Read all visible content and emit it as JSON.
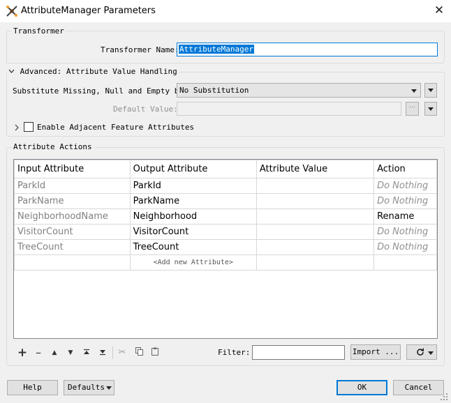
{
  "window": {
    "title": "AttributeManager Parameters",
    "close_glyph": "✕"
  },
  "transformer": {
    "group_title": "Transformer",
    "name_label": "Transformer Name:",
    "name_value": "AttributeManager"
  },
  "advanced": {
    "group_title": "Advanced: Attribute Value Handling",
    "substitute_label": "Substitute Missing, Null and Empty by:",
    "substitute_value": "No Substitution",
    "default_label": "Default Value:",
    "default_value": "",
    "ellipsis": "···",
    "adjacent_label": "Enable Adjacent Feature Attributes",
    "adjacent_checked": false
  },
  "actions": {
    "group_title": "Attribute Actions",
    "columns": [
      "Input Attribute",
      "Output Attribute",
      "Attribute Value",
      "Action"
    ],
    "rows": [
      {
        "input": "ParkId",
        "output": "ParkId",
        "value": "",
        "action": "Do Nothing"
      },
      {
        "input": "ParkName",
        "output": "ParkName",
        "value": "",
        "action": "Do Nothing"
      },
      {
        "input": "NeighborhoodName",
        "output": "Neighborhood",
        "value": "",
        "action": "Rename"
      },
      {
        "input": "VisitorCount",
        "output": "VisitorCount",
        "value": "",
        "action": "Do Nothing"
      },
      {
        "input": "TreeCount",
        "output": "TreeCount",
        "value": "",
        "action": "Do Nothing"
      }
    ],
    "add_new": "<Add new Attribute>",
    "filter_label": "Filter:",
    "filter_value": "",
    "import_label": "Import ..."
  },
  "footer": {
    "help": "Help",
    "defaults": "Defaults",
    "ok": "OK",
    "cancel": "Cancel"
  },
  "colors": {
    "selection": "#0078d7",
    "accent_border": "#0078d7"
  }
}
